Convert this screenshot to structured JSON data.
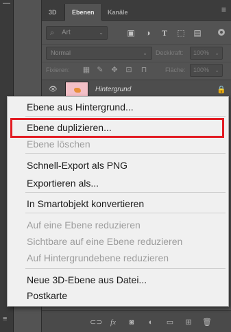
{
  "tabs": {
    "items": [
      {
        "label": "3D"
      },
      {
        "label": "Ebenen"
      },
      {
        "label": "Kanäle"
      }
    ],
    "menu_icon": "hamburger-icon"
  },
  "filter": {
    "select_value": "Art",
    "search_icon": "search-icon",
    "icons": [
      "image-filter-icon",
      "adjustment-filter-icon",
      "type-filter-icon",
      "shape-filter-icon",
      "smartobject-filter-icon"
    ]
  },
  "blend": {
    "mode": "Normal",
    "opacity_label": "Deckkraft:",
    "opacity_value": "100%"
  },
  "locks": {
    "label": "Fixieren:",
    "fill_label": "Fläche:",
    "fill_value": "100%"
  },
  "layer": {
    "name": "Hintergrund",
    "eye_icon": "eye-icon",
    "lock_icon": "lock-icon"
  },
  "context_menu": {
    "item_from_background": "Ebene aus Hintergrund...",
    "item_duplicate": "Ebene duplizieren...",
    "item_delete": "Ebene löschen",
    "item_quick_export": "Schnell-Export als PNG",
    "item_export_as": "Exportieren als...",
    "item_smart_object": "In Smartobjekt konvertieren",
    "item_merge_down": "Auf eine Ebene reduzieren",
    "item_merge_visible": "Sichtbare auf eine Ebene reduzieren",
    "item_flatten": "Auf Hintergrundebene reduzieren",
    "item_new_3d": "Neue 3D-Ebene aus Datei...",
    "item_postcard": "Postkarte",
    "highlight_color": "#e21c23"
  },
  "bottom_bar": {
    "icons": [
      "link-icon",
      "fx-icon",
      "mask-icon",
      "adjustment-icon",
      "group-folder-icon",
      "new-layer-icon",
      "trash-icon"
    ]
  }
}
